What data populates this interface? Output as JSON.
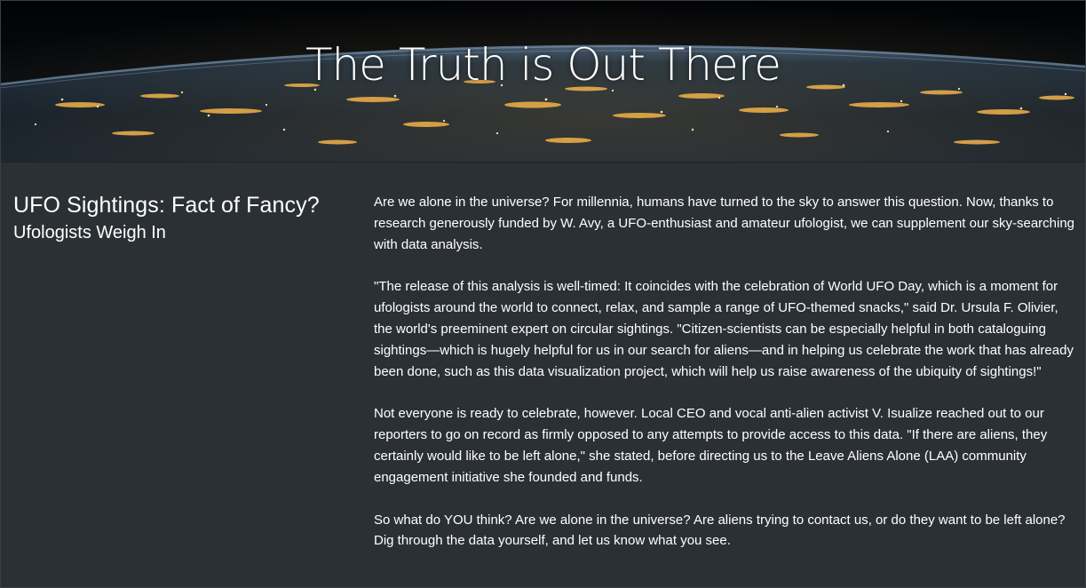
{
  "header": {
    "title": "The Truth is Out There"
  },
  "sidebar": {
    "heading": "UFO Sightings: Fact of Fancy?",
    "subheading": "Ufologists Weigh In"
  },
  "article": {
    "paragraphs": [
      "Are we alone in the universe? For millennia, humans have turned to the sky to answer this question. Now, thanks to research generously funded by W. Avy, a UFO-enthusiast and amateur ufologist, we can supplement our sky-searching with data analysis.",
      "\"The release of this analysis is well-timed: It coincides with the celebration of World UFO Day, which is a moment for ufologists around the world to connect, relax, and sample a range of UFO-themed snacks,\" said Dr. Ursula F. Olivier, the world's preeminent expert on circular sightings. \"Citizen-scientists can be especially helpful in both cataloguing sightings—which is hugely helpful for us in our search for aliens—and in helping us celebrate the work that has already been done, such as this data visualization project, which will help us raise awareness of the ubiquity of sightings!\"",
      "Not everyone is ready to celebrate, however. Local CEO and vocal anti-alien activist V. Isualize reached out to our reporters to go on record as firmly opposed to any attempts to provide access to this data. \"If there are aliens, they certainly would like to be left alone,\" she stated, before directing us to the Leave Aliens Alone (LAA) community engagement initiative she founded and funds.",
      "So what do YOU think? Are we alone in the universe? Are aliens trying to contact us, or do they want to be left alone? Dig through the data yourself, and let us know what you see."
    ]
  },
  "colors": {
    "page_background": "#2b3035",
    "text": "#ffffff",
    "city_lights": "#f2b24a"
  }
}
